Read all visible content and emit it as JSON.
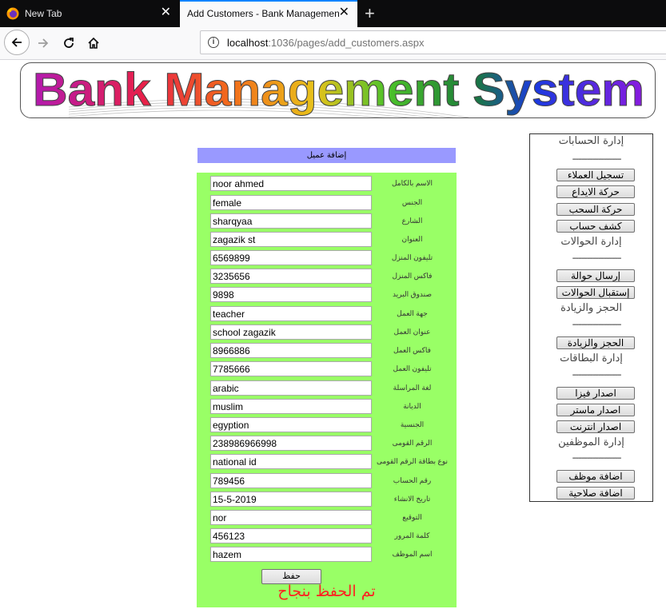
{
  "browser": {
    "tabs": [
      {
        "title": "New Tab"
      },
      {
        "title": "Add Customers - Bank Management System"
      }
    ],
    "url_host": "localhost",
    "url_rest": ":1036/pages/add_customers.aspx"
  },
  "banner": {
    "title": "Bank Management System"
  },
  "form": {
    "header": "إضافة عميل",
    "fields": [
      {
        "label": "الاسم بالكامل",
        "value": "noor ahmed"
      },
      {
        "label": "الجنس",
        "value": "female"
      },
      {
        "label": "الشارع",
        "value": "sharqyaa"
      },
      {
        "label": "العنوان",
        "value": "zagazik st"
      },
      {
        "label": "تليفون المنزل",
        "value": "6569899"
      },
      {
        "label": "فاكس المنزل",
        "value": "3235656"
      },
      {
        "label": "صندوق البريد",
        "value": "9898"
      },
      {
        "label": "جهة العمل",
        "value": "teacher"
      },
      {
        "label": "عنوان العمل",
        "value": "school zagazik"
      },
      {
        "label": "فاكس العمل",
        "value": "8966886"
      },
      {
        "label": "تليفون العمل",
        "value": "7785666"
      },
      {
        "label": "لغة المراسلة",
        "value": "arabic"
      },
      {
        "label": "الديانة",
        "value": "muslim"
      },
      {
        "label": "الجنسية",
        "value": "egyption"
      },
      {
        "label": "الرقم القومى",
        "value": "238986966998"
      },
      {
        "label": "نوع بطاقة الرقم القومى",
        "value": "national id"
      },
      {
        "label": "رقم الحساب",
        "value": "789456"
      },
      {
        "label": "تاريخ الانشاء",
        "value": "15-5-2019"
      },
      {
        "label": "التوقيع",
        "value": "nor"
      },
      {
        "label": "كلمة المرور",
        "value": "456123"
      },
      {
        "label": "اسم الموظف",
        "value": "hazem"
      }
    ],
    "save_label": "حفظ",
    "success_message": "تم الحفظ بنجاح"
  },
  "sidebar": {
    "separator": "--------------------------",
    "sections": [
      {
        "title": "إدارة الحسابات",
        "buttons": [
          "تسجيل العملاء",
          "حركة الايداع",
          "حركة السحب",
          "كشف حساب"
        ]
      },
      {
        "title": "إدارة الحوالات",
        "buttons": [
          "إرسال حوالة",
          "إستقبال الحوالات"
        ]
      },
      {
        "title": "الحجز والزيادة",
        "buttons": [
          "الحجز والزيادة"
        ]
      },
      {
        "title": "إدارة البطاقات",
        "buttons": [
          "اصدار فيزا",
          "اصدار ماستر",
          "اصدار انترنت"
        ]
      },
      {
        "title": "إدارة الموظفين",
        "buttons": [
          "اضافة موظف",
          "اضافة صلاحية"
        ]
      }
    ]
  }
}
